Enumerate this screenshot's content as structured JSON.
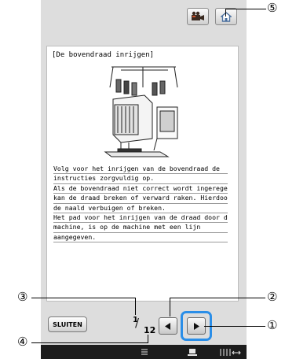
{
  "content": {
    "title": "[De bovendraad inrijgen]",
    "lines": [
      " Volg voor het inrijgen van de bovendraad de",
      "instructies zorgvuldig op.",
      " Als de bovendraad niet correct wordt ingeregen,",
      "kan de draad breken of verward raken. Hierdoor kan",
      "de naald verbuigen of breken.",
      " Het pad voor het inrijgen van de draad door de",
      "machine, is op de machine met een lijn",
      "aangegeven."
    ]
  },
  "toolbar": {
    "video_icon": "video-camera-icon",
    "home_icon": "home-icon"
  },
  "footer": {
    "close_label": "SLUITEN",
    "page_current": "1",
    "page_slash": "/",
    "page_total": "12",
    "prev_icon": "left-arrow-icon",
    "next_icon": "right-arrow-icon"
  },
  "callouts": {
    "c1": "①",
    "c2": "②",
    "c3": "③",
    "c4": "④",
    "c5": "⑤"
  },
  "colors": {
    "screen_bg": "#dddddd",
    "highlight": "#2a8ee8",
    "bottombar": "#1c1c1c"
  }
}
